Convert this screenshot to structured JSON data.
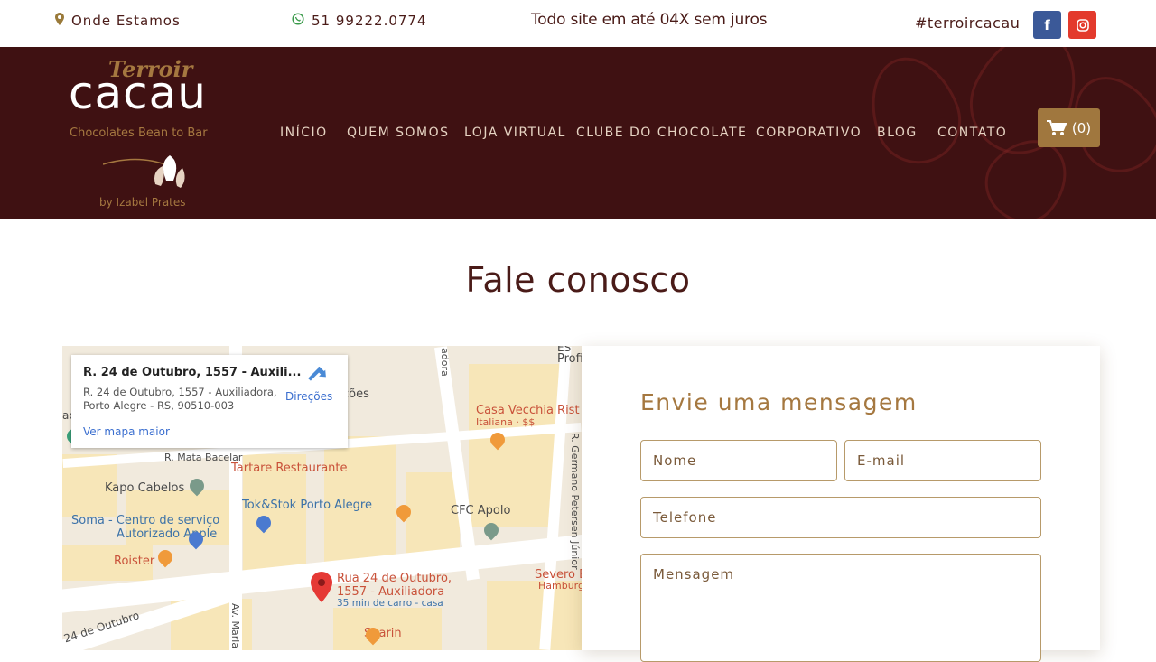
{
  "topbar": {
    "location_label": "Onde Estamos",
    "location_icon": "map-pin-icon",
    "phone": "51 99222.0774",
    "phone_icon": "whatsapp-icon",
    "promo": "Todo site em até 04X sem juros",
    "hashtag": "#terroircacau",
    "facebook_glyph": "f",
    "instagram_icon": "instagram-icon"
  },
  "logo": {
    "terroir": "Terroir",
    "cacau": "cacau",
    "tagline": "Chocolates Bean to Bar",
    "by": "by Izabel Prates"
  },
  "nav": {
    "items": [
      "INÍCIO",
      "QUEM SOMOS",
      "LOJA VIRTUAL",
      "CLUBE DO CHOCOLATE",
      "CORPORATIVO",
      "BLOG",
      "CONTATO"
    ]
  },
  "cart": {
    "count": "(0)",
    "icon": "cart-icon"
  },
  "page": {
    "title": "Fale conosco"
  },
  "map": {
    "card": {
      "title": "R. 24 de Outubro, 1557 - Auxili...",
      "address_line1": "R. 24 de Outubro, 1557 - Auxiliadora,",
      "address_line2": "Porto Alegre - RS, 90510-003",
      "larger_map": "Ver mapa maior",
      "directions": "Direções"
    },
    "labels": {
      "profissio": "Profissio",
      "coes": "ções",
      "casa_vecchia": "Casa Vecchia Rist",
      "italiana": "Italiana · $$",
      "mata_bacelar": "R. Mata Bacelar",
      "tartare": "Tartare Restaurante",
      "kapo": "Kapo Cabelos",
      "tokstok": "Tok&Stok Porto Alegre",
      "soma1": "Soma - Centro de serviço",
      "soma2": "Autorizado Apple",
      "cfc": "CFC Apolo",
      "roister": "Roister",
      "severo1": "Severo E",
      "severo2": "Hamburg",
      "marker1": "Rua 24 de Outubro,",
      "marker2": "1557 - Auxiliadora",
      "marker3": "35 min de carro - casa",
      "sharin": "Sharin",
      "outubro": "24 de Outubro",
      "av_maria": "Av. Maria",
      "germano": "R. Germano Petersen Júnior",
      "adora": "adora",
      "ac": "ac",
      "es": "ES"
    }
  },
  "form": {
    "title": "Envie uma mensagem",
    "name_placeholder": "Nome",
    "email_placeholder": "E-mail",
    "phone_placeholder": "Telefone",
    "message_placeholder": "Mensagem"
  },
  "colors": {
    "header_bg": "#3f1112",
    "accent_gold": "#a57840",
    "dark_brown": "#4a1b18",
    "facebook": "#3b5998",
    "instagram": "#e33a2c"
  }
}
